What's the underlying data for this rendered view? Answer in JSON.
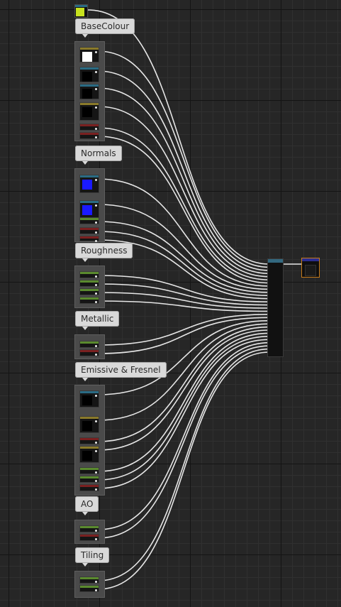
{
  "comment_labels": {
    "base_colour": "BaseColour",
    "normals": "Normals",
    "roughness": "Roughness",
    "metallic": "Metallic",
    "emissive_fresnel": "Emissive & Fresnel",
    "ao": "AO",
    "tiling": "Tiling"
  },
  "colors": {
    "grid_background": "#262626",
    "wire": "#e6e6e6",
    "comment_fill": "#d9d9d9",
    "texture_header": "#2a6b84",
    "vector_header": "#8a7a2a",
    "scalar_header": "#5a8a2e",
    "color_header": "#7a2020",
    "output_border": "#c47a1a",
    "lime_swatch": "#c7e21e",
    "white_swatch": "#ffffff",
    "blue_swatch": "#1a1aff",
    "black_swatch": "#000000"
  },
  "icons": {
    "node_output_pin": "dot",
    "node_preview": "swatch"
  }
}
